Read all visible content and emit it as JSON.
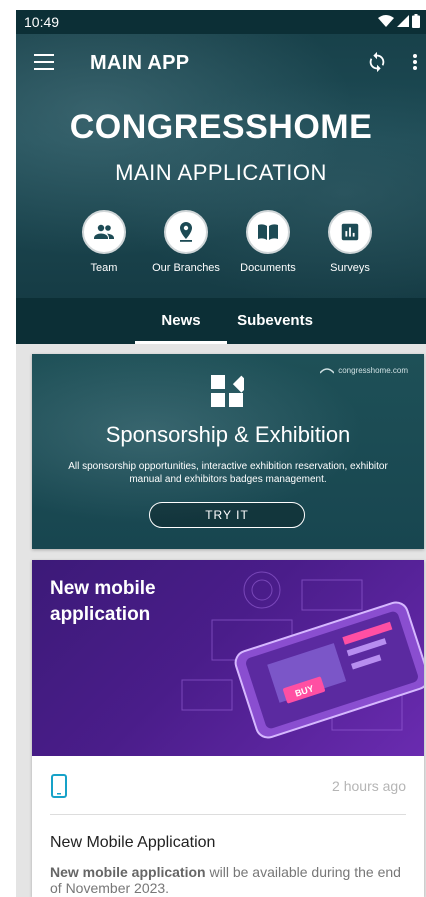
{
  "status": {
    "time": "10:49"
  },
  "appbar": {
    "title": "MAIN APP",
    "menu_icon": "menu-icon",
    "sync_icon": "sync-icon",
    "more_icon": "more-vert-icon"
  },
  "hero": {
    "title": "CONGRESSHOME",
    "subtitle": "MAIN APPLICATION"
  },
  "quick_actions": [
    {
      "label": "Team",
      "icon": "team-icon"
    },
    {
      "label": "Our Branches",
      "icon": "location-pin-icon"
    },
    {
      "label": "Documents",
      "icon": "book-icon"
    },
    {
      "label": "Surveys",
      "icon": "bar-chart-icon"
    }
  ],
  "tabs": [
    {
      "label": "News",
      "active": true
    },
    {
      "label": "Subevents",
      "active": false
    }
  ],
  "sponsorship_card": {
    "logo_text": "congresshome.com",
    "title": "Sponsorship & Exhibition",
    "text": "All sponsorship opportunities, interactive exhibition reservation, exhibitor manual and exhibitors badges management.",
    "button": "TRY IT"
  },
  "news_card": {
    "image_title": "New mobile application",
    "image_badge": "BUY",
    "time_ago": "2 hours ago",
    "headline": "New Mobile Application",
    "body_bold": "New mobile application",
    "body_rest": " will be available during the end of November 2023."
  },
  "colors": {
    "primary_dark": "#0c2f36",
    "hero": "#1d4b55",
    "accent": "#17a2c8",
    "purple": "#4a1d8a"
  }
}
